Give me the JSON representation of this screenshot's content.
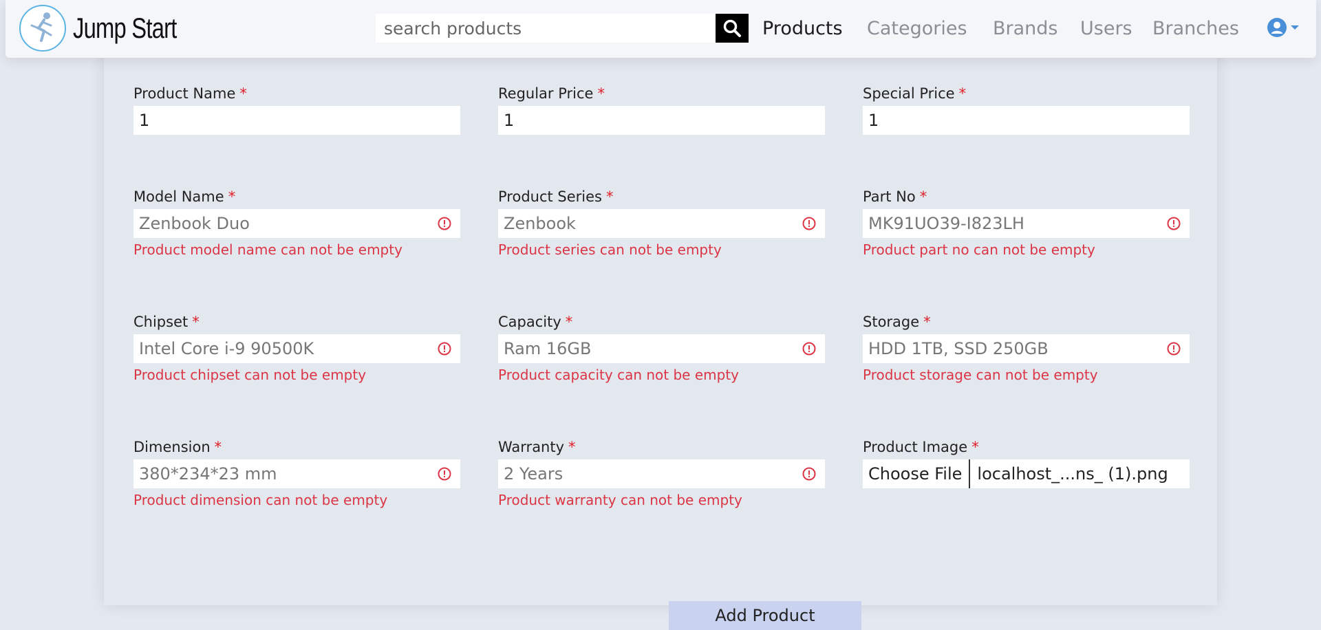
{
  "navbar": {
    "brand": "Jump Start",
    "search_placeholder": "search products",
    "links": [
      "Products",
      "Categories",
      "Brands",
      "Users",
      "Branches"
    ],
    "active_link": "Products"
  },
  "form": {
    "required_mark": "*",
    "product_name": {
      "label": "Product Name",
      "value": "1"
    },
    "regular_price": {
      "label": "Regular Price",
      "value": "1"
    },
    "special_price": {
      "label": "Special Price",
      "value": "1"
    },
    "model_name": {
      "label": "Model Name",
      "placeholder": "Zenbook Duo",
      "error": "Product model name can not be empty"
    },
    "product_series": {
      "label": "Product Series",
      "placeholder": "Zenbook",
      "error": "Product series can not be empty"
    },
    "part_no": {
      "label": "Part No",
      "placeholder": "MK91UO39-I823LH",
      "error": "Product part no can not be empty"
    },
    "chipset": {
      "label": "Chipset",
      "placeholder": "Intel Core i-9 90500K",
      "error": "Product chipset can not be empty"
    },
    "capacity": {
      "label": "Capacity",
      "placeholder": "Ram 16GB",
      "error": "Product capacity can not be empty"
    },
    "storage": {
      "label": "Storage",
      "placeholder": "HDD 1TB, SSD 250GB",
      "error": "Product storage can not be empty"
    },
    "dimension": {
      "label": "Dimension",
      "placeholder": "380*234*23 mm",
      "error": "Product dimension can not be empty"
    },
    "warranty": {
      "label": "Warranty",
      "placeholder": "2 Years",
      "error": "Product warranty can not be empty"
    },
    "product_image": {
      "label": "Product Image",
      "button": "Choose File",
      "file_name": "localhost_...ns_ (1).png"
    },
    "submit_label": "Add Product"
  },
  "colors": {
    "error": "#dc3545",
    "required": "#e0202a",
    "submit_bg": "#c9d3ef",
    "accent": "#4a90d9"
  },
  "icons": {
    "search": "search-icon",
    "error": "exclamation-circle-icon",
    "user": "user-circle-icon",
    "caret": "caret-down-icon"
  }
}
